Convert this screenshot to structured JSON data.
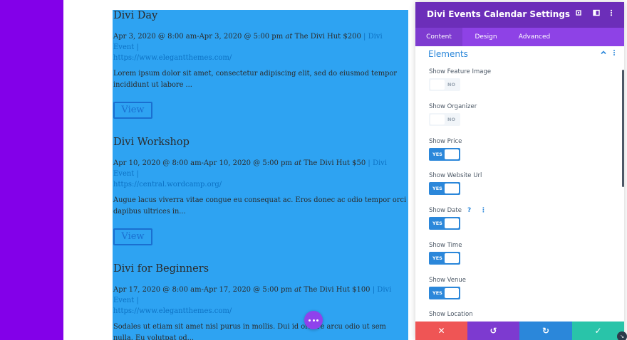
{
  "colors": {
    "left_bar": "#8300e9",
    "events_bg": "#2ea3f2",
    "panel_header": "#6c2eb9",
    "panel_tabs": "#8e42e6",
    "accent": "#2b87da",
    "footer_cancel": "#ef5555",
    "footer_undo": "#7d3ad0",
    "footer_redo": "#2b87da",
    "footer_save": "#29c4a9"
  },
  "events": [
    {
      "title": "Divi Day",
      "date": "Apr 3, 2020 @ 8:00 am-Apr 3, 2020 @ 5:00 pm",
      "at": "at",
      "venue": "The Divi Hut $200",
      "sep1": "|",
      "category": "Divi Event",
      "sep2": "|",
      "url": "https://www.elegantthemes.com/",
      "excerpt": "Lorem ipsum dolor sit amet, consectetur adipiscing elit, sed do eiusmod tempor incididunt ut labore ...",
      "button": "View"
    },
    {
      "title": "Divi Workshop",
      "date": "Apr 10, 2020 @ 8:00 am-Apr 10, 2020 @ 5:00 pm",
      "at": "at",
      "venue": "The Divi Hut $50",
      "sep1": "|",
      "category": "Divi Event",
      "sep2": "|",
      "url": "https://central.wordcamp.org/",
      "excerpt": "Augue lacus viverra vitae congue eu consequat ac. Eros donec ac odio tempor orci dapibus ultrices in...",
      "button": "View"
    },
    {
      "title": "Divi for Beginners",
      "date": "Apr 17, 2020 @ 8:00 am-Apr 17, 2020 @ 5:00 pm",
      "at": "at",
      "venue": "The Divi Hut $100",
      "sep1": "|",
      "category": "Divi Event",
      "sep2": "|",
      "url": "https://www.elegantthemes.com/",
      "excerpt": "Sodales ut etiam sit amet nisl purus in mollis. Dui id ornare arcu odio ut sem nulla. Eu volutpat od...",
      "button": "View"
    }
  ],
  "panel": {
    "title": "Divi Events Calendar Settings",
    "header_icons": [
      "expand-icon",
      "sidebar-icon",
      "more-vertical-icon"
    ],
    "tabs": [
      {
        "label": "Content",
        "active": true
      },
      {
        "label": "Design",
        "active": false
      },
      {
        "label": "Advanced",
        "active": false
      }
    ],
    "section_title": "Elements",
    "section_toggle_icon": "chevron-up-icon",
    "section_more_icon": "more-vertical-icon",
    "settings": [
      {
        "label": "Show Feature Image",
        "value": "NO",
        "on": false
      },
      {
        "label": "Show Organizer",
        "value": "NO",
        "on": false
      },
      {
        "label": "Show Price",
        "value": "YES",
        "on": true
      },
      {
        "label": "Show Website Url",
        "value": "YES",
        "on": true
      },
      {
        "label": "Show Date",
        "value": "YES",
        "on": true,
        "help": "?",
        "more": "⋮"
      },
      {
        "label": "Show Time",
        "value": "YES",
        "on": true
      },
      {
        "label": "Show Venue",
        "value": "YES",
        "on": true
      },
      {
        "label": "Show Location",
        "value": "",
        "on": null
      }
    ],
    "footer": {
      "cancel": "✕",
      "undo": "↺",
      "redo": "↻",
      "save": "✓"
    }
  }
}
